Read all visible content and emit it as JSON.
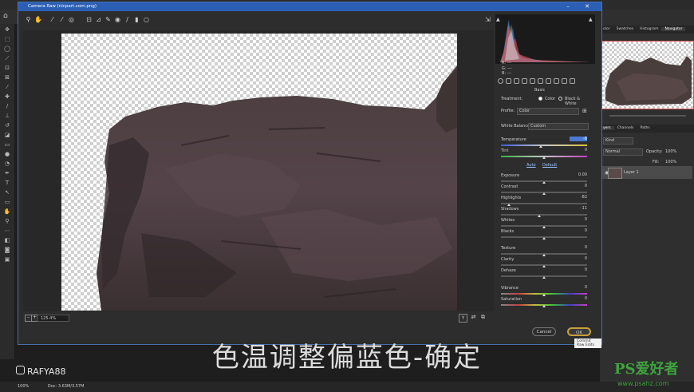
{
  "dialog": {
    "title": "Camera Raw (nicpart.com.png)",
    "zoom_level": "125.4%",
    "cancel_label": "Cancel",
    "ok_label": "OK",
    "ok_tooltip": "Commit Raw Edits"
  },
  "histogram": {
    "r_label": "R:",
    "g_label": "G:",
    "b_label": "B:",
    "r_value": "---",
    "g_value": "---",
    "b_value": "---"
  },
  "panel": {
    "title": "Basic",
    "treatment_label": "Treatment:",
    "treatment_color": "Color",
    "treatment_bw": "Black & White",
    "profile_label": "Profile:",
    "profile_value": "Color",
    "wb_label": "White Balance:",
    "wb_value": "Custom",
    "auto_label": "Auto",
    "default_label": "Default",
    "sliders": [
      {
        "label": "Temperature",
        "value": "-8",
        "level": 0.46
      },
      {
        "label": "Tint",
        "value": "0",
        "level": 0.5
      },
      {
        "label": "Exposure",
        "value": "0.00",
        "level": 0.5
      },
      {
        "label": "Contrast",
        "value": "0",
        "level": 0.5
      },
      {
        "label": "Highlights",
        "value": "-82",
        "level": 0.09
      },
      {
        "label": "Shadows",
        "value": "-11",
        "level": 0.44
      },
      {
        "label": "Whites",
        "value": "0",
        "level": 0.5
      },
      {
        "label": "Blacks",
        "value": "0",
        "level": 0.5
      },
      {
        "label": "Texture",
        "value": "0",
        "level": 0.5
      },
      {
        "label": "Clarity",
        "value": "0",
        "level": 0.5
      },
      {
        "label": "Dehaze",
        "value": "0",
        "level": 0.5
      },
      {
        "label": "Vibrance",
        "value": "0",
        "level": 0.5
      },
      {
        "label": "Saturation",
        "value": "0",
        "level": 0.5
      }
    ]
  },
  "ps_right": {
    "top_tabs": [
      "olor",
      "Swatches",
      "Histogram",
      "Navigator"
    ],
    "layer_tabs": [
      "yers",
      "Channels",
      "Paths"
    ],
    "kind_label": "Kind",
    "blend_mode": "Normal",
    "opacity_label": "Opacity:",
    "opacity_value": "100%",
    "fill_label": "Fill:",
    "fill_value": "100%",
    "layer_name": "Layer 1"
  },
  "statusbar": {
    "zoom": "100%",
    "doc": "Doc: 3.63M/3.57M"
  },
  "subtitle": "色温调整偏蓝色-确定",
  "watermark": {
    "handle": "RAFYA88",
    "site_logo": "PS爱好者",
    "site_url": "www.psahz.com"
  },
  "colors": {
    "accent": "#2b5fb3",
    "bg": "#1e1e1e",
    "ok_ring": "#c8a03a"
  }
}
